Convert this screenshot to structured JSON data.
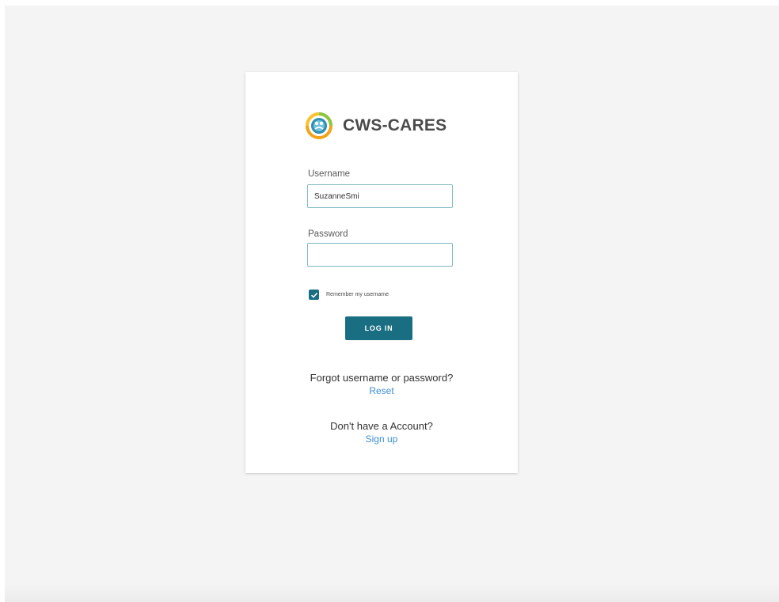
{
  "app": {
    "brand_name": "CWS-CARES"
  },
  "login_form": {
    "username_label": "Username",
    "username_value": "SuzanneSmi",
    "password_label": "Password",
    "password_value": "",
    "remember_label": "Remember my username",
    "remember_checked": true,
    "login_button_label": "LOG IN"
  },
  "recovery": {
    "forgot_prompt": "Forgot username or password?",
    "reset_link": "Reset"
  },
  "signup": {
    "prompt": "Don't have a Account?",
    "signup_link": "Sign up"
  },
  "colors": {
    "accent": "#1a6e82",
    "link": "#3e8ed0",
    "background": "#f4f4f4"
  },
  "icons": {
    "logo": "cws-cares-logo-icon",
    "checkbox": "checkmark-icon"
  }
}
